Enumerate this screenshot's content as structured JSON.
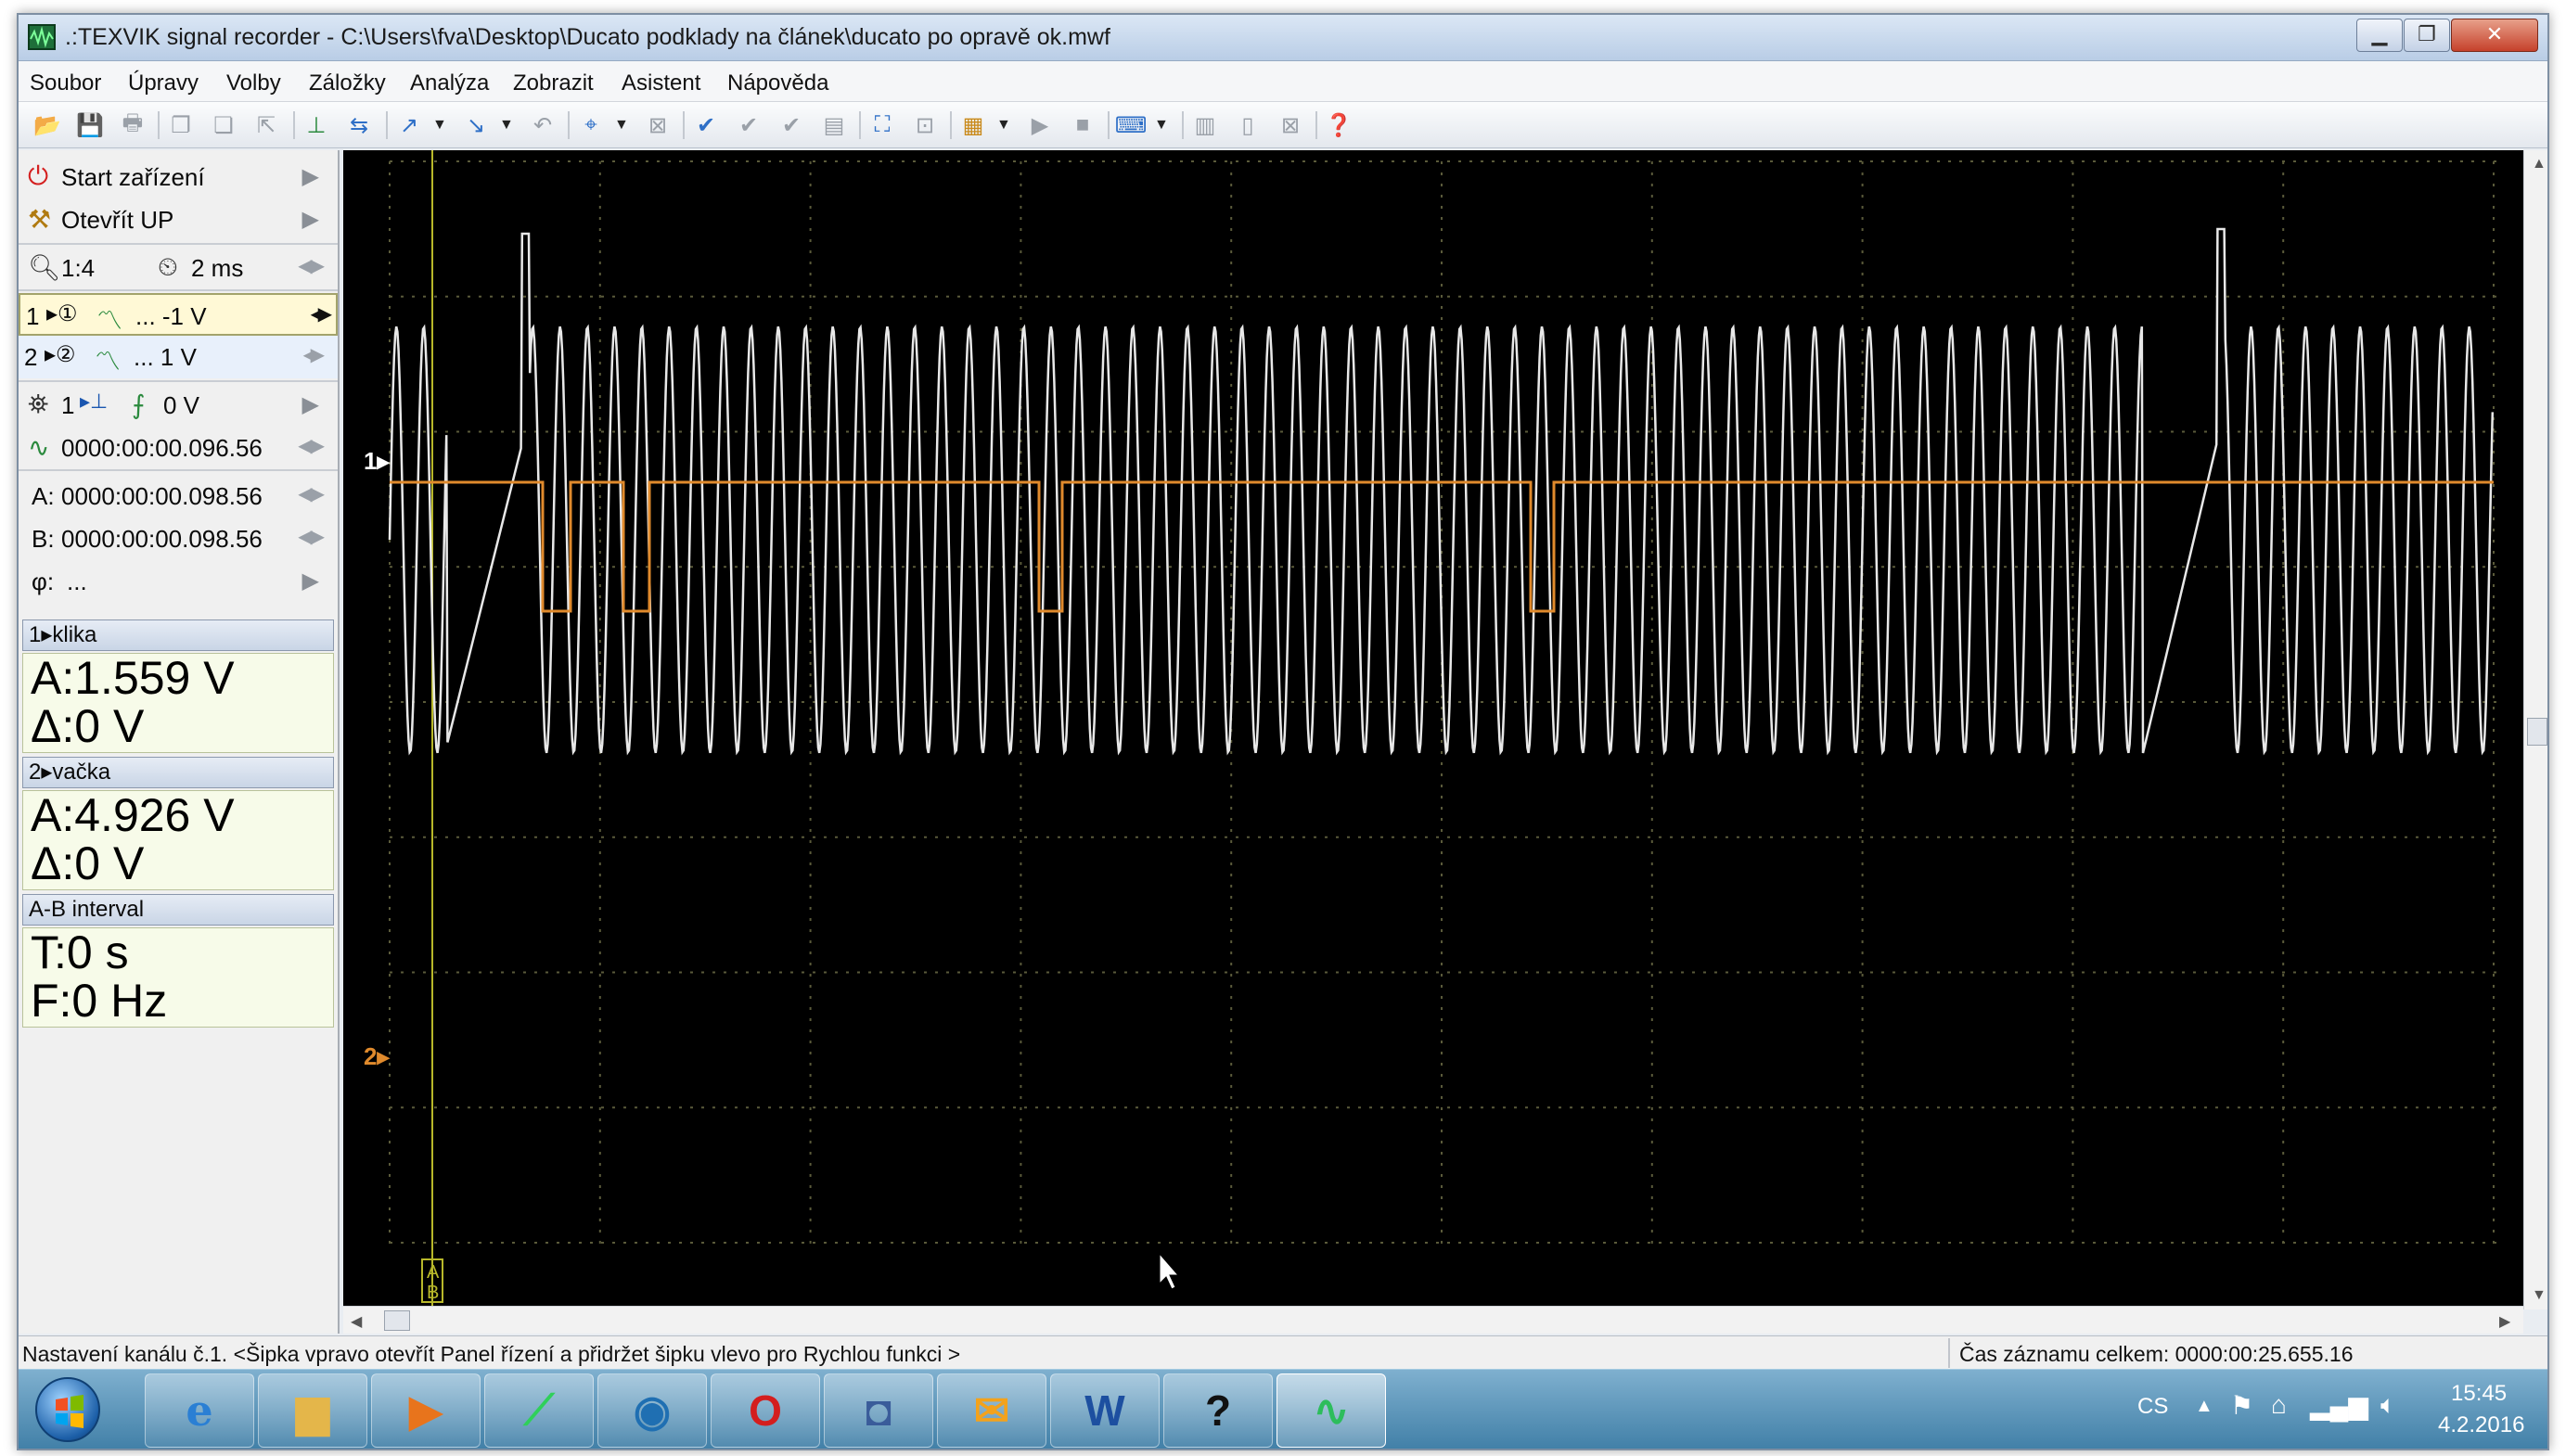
{
  "window": {
    "title": ".:TEXVIK  signal recorder - C:\\Users\\fva\\Desktop\\Ducato podklady na článek\\ducato po opravě ok.mwf",
    "min": "▁",
    "max": "❐",
    "close": "✕"
  },
  "menu": [
    "Soubor",
    "Úpravy",
    "Volby",
    "Záložky",
    "Analýza",
    "Zobrazit",
    "Asistent",
    "Nápověda"
  ],
  "panel": {
    "start": "Start zařízení",
    "open": "Otevřít UP",
    "zoom": "1:4",
    "timebase": "2 ms",
    "ch1_num": "1",
    "ch1_setting": "... -1 V",
    "ch2_num": "2",
    "ch2_setting": "... 1 V",
    "trigger_ch": "1",
    "trigger_level": "0 V",
    "position": "0000:00:00.096.56",
    "cursor_a_label": "A:",
    "cursor_a": "0000:00:00.098.56",
    "cursor_b_label": "B:",
    "cursor_b": "0000:00:00.098.56",
    "phi_label": "φ:",
    "phi": "..."
  },
  "measurements": {
    "ch1": {
      "header": "1▸klika",
      "a": "A:1.559 V",
      "delta": "Δ:0 V"
    },
    "ch2": {
      "header": "2▸vačka",
      "a": "A:4.926 V",
      "delta": "Δ:0 V"
    },
    "interval": {
      "header": "A-B interval",
      "t": "T:0 s",
      "f": "F:0 Hz"
    }
  },
  "scope": {
    "ch1_marker": "1▸",
    "ch2_marker": "2▸",
    "cursor_a": "A",
    "cursor_b": "B",
    "ch1_color": "#e8e8e8",
    "ch2_color": "#e08a2c",
    "background": "#000000",
    "grid_color": "#5a5a3a"
  },
  "status": {
    "hint": "Nastavení kanálu č.1. <Šipka vpravo otevřít Panel řízení a přidržet šipku vlevo pro Rychlou funkci >",
    "record_time": "Čas záznamu celkem: 0000:00:25.655.16"
  },
  "taskbar": {
    "ie": "e",
    "opera": "O",
    "word": "W",
    "help": "?",
    "lang": "CS",
    "time": "15:45",
    "date": "4.2.2016"
  }
}
